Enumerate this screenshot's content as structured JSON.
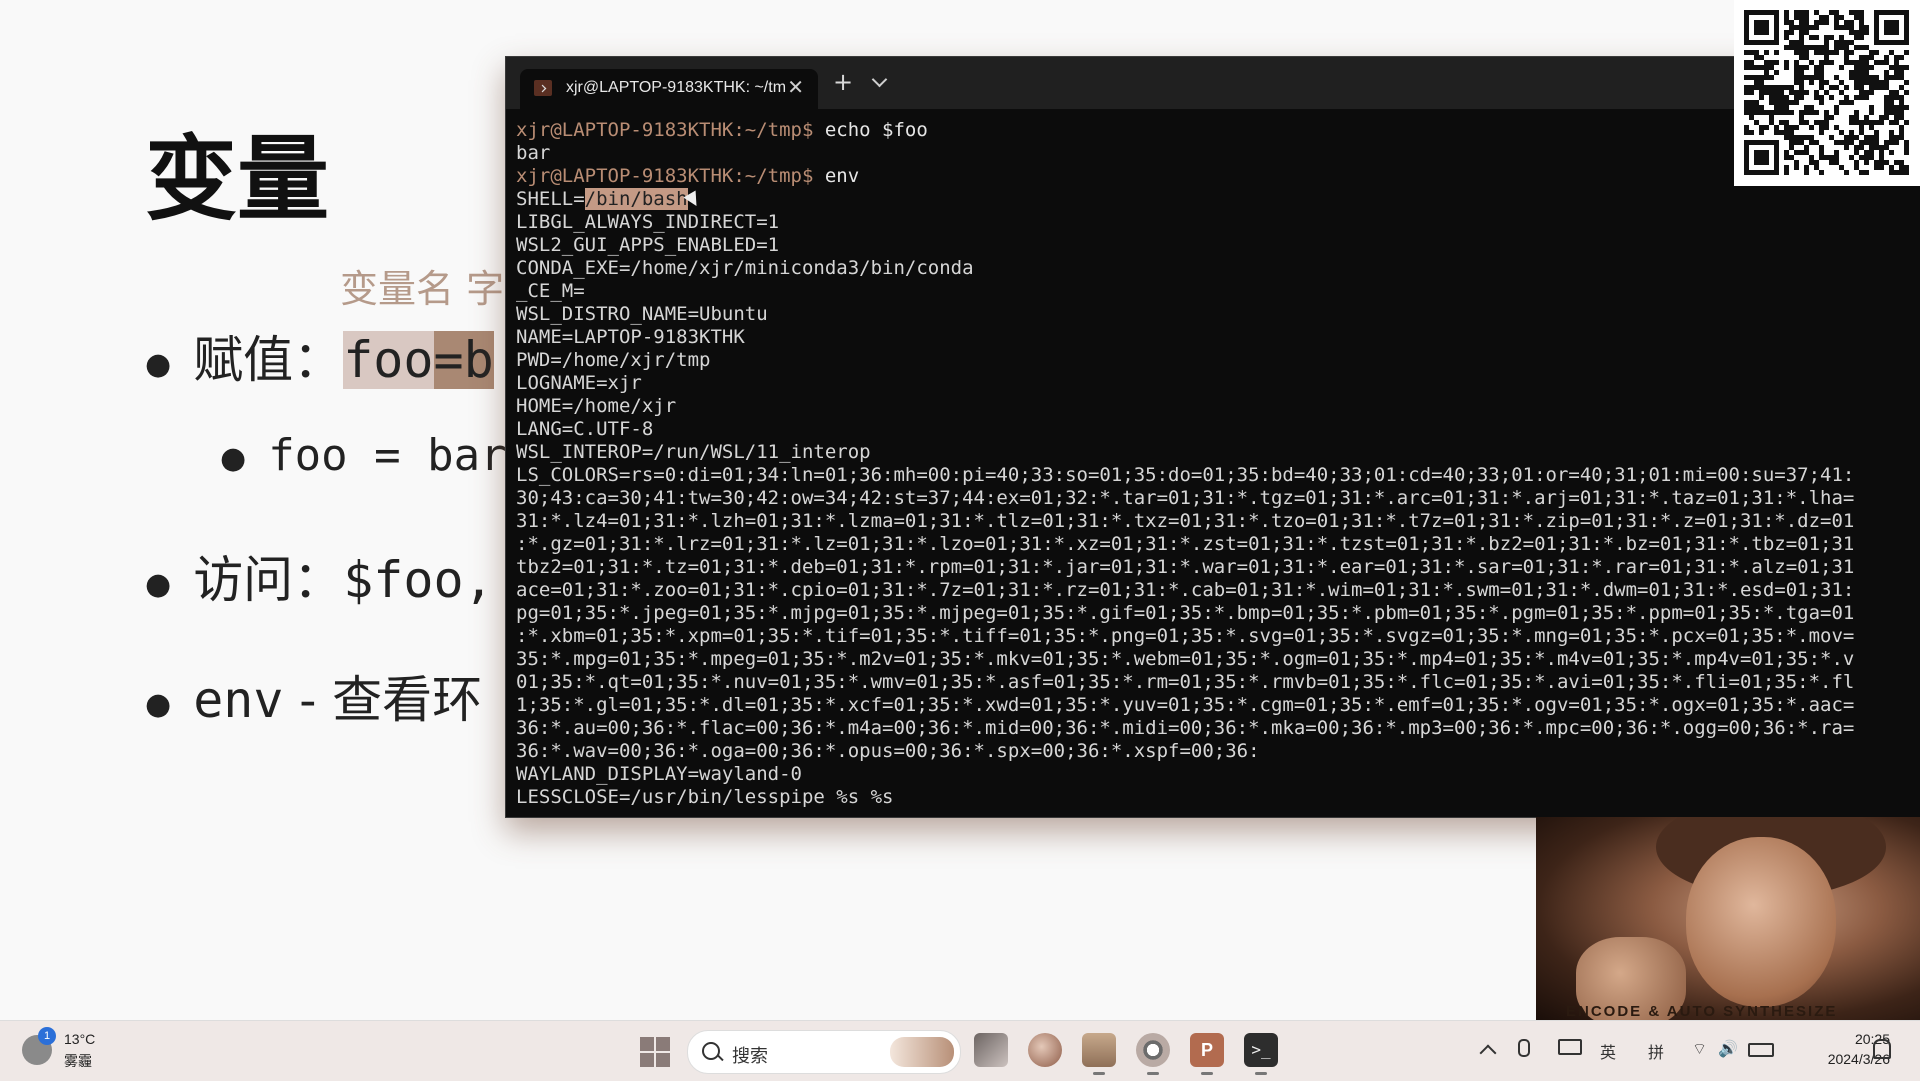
{
  "slide": {
    "faint_header": "",
    "title": "变量",
    "subtitle": "变量名  字",
    "bullets": [
      {
        "label": "赋值：",
        "code": "foo",
        "code2": "=b"
      },
      {
        "code": "foo  =  bar"
      },
      {
        "label": "访问：",
        "code": "$foo,"
      },
      {
        "code": "env",
        "label": " - 查看环"
      }
    ]
  },
  "terminal": {
    "tab_title": "xjr@LAPTOP-9183KTHK: ~/tm",
    "tab_close": "✕",
    "new_tab": "+",
    "prompt": "xjr@LAPTOP-9183KTHK:~/tmp$",
    "cmd1": " echo $foo",
    "out1": "bar",
    "cmd2": " env",
    "shell_key": "SHELL=",
    "shell_val": "/bin/bash",
    "env_lines": [
      "LIBGL_ALWAYS_INDIRECT=1",
      "WSL2_GUI_APPS_ENABLED=1",
      "CONDA_EXE=/home/xjr/miniconda3/bin/conda",
      "_CE_M=",
      "WSL_DISTRO_NAME=Ubuntu",
      "NAME=LAPTOP-9183KTHK",
      "PWD=/home/xjr/tmp",
      "LOGNAME=xjr",
      "HOME=/home/xjr",
      "LANG=C.UTF-8",
      "WSL_INTEROP=/run/WSL/11_interop",
      "LS_COLORS=rs=0:di=01;34:ln=01;36:mh=00:pi=40;33:so=01;35:do=01;35:bd=40;33;01:cd=40;33;01:or=40;31;01:mi=00:su=37;41:",
      "30;43:ca=30;41:tw=30;42:ow=34;42:st=37;44:ex=01;32:*.tar=01;31:*.tgz=01;31:*.arc=01;31:*.arj=01;31:*.taz=01;31:*.lha=",
      "31:*.lz4=01;31:*.lzh=01;31:*.lzma=01;31:*.tlz=01;31:*.txz=01;31:*.tzo=01;31:*.t7z=01;31:*.zip=01;31:*.z=01;31:*.dz=01",
      ":*.gz=01;31:*.lrz=01;31:*.lz=01;31:*.lzo=01;31:*.xz=01;31:*.zst=01;31:*.tzst=01;31:*.bz2=01;31:*.bz=01;31:*.tbz=01;31",
      "tbz2=01;31:*.tz=01;31:*.deb=01;31:*.rpm=01;31:*.jar=01;31:*.war=01;31:*.ear=01;31:*.sar=01;31:*.rar=01;31:*.alz=01;31",
      "ace=01;31:*.zoo=01;31:*.cpio=01;31:*.7z=01;31:*.rz=01;31:*.cab=01;31:*.wim=01;31:*.swm=01;31:*.dwm=01;31:*.esd=01;31:",
      "pg=01;35:*.jpeg=01;35:*.mjpg=01;35:*.mjpeg=01;35:*.gif=01;35:*.bmp=01;35:*.pbm=01;35:*.pgm=01;35:*.ppm=01;35:*.tga=01",
      ":*.xbm=01;35:*.xpm=01;35:*.tif=01;35:*.tiff=01;35:*.png=01;35:*.svg=01;35:*.svgz=01;35:*.mng=01;35:*.pcx=01;35:*.mov=",
      "35:*.mpg=01;35:*.mpeg=01;35:*.m2v=01;35:*.mkv=01;35:*.webm=01;35:*.ogm=01;35:*.mp4=01;35:*.m4v=01;35:*.mp4v=01;35:*.v",
      "01;35:*.qt=01;35:*.nuv=01;35:*.wmv=01;35:*.asf=01;35:*.rm=01;35:*.rmvb=01;35:*.flc=01;35:*.avi=01;35:*.fli=01;35:*.fl",
      "1;35:*.gl=01;35:*.dl=01;35:*.xcf=01;35:*.xwd=01;35:*.yuv=01;35:*.cgm=01;35:*.emf=01;35:*.ogv=01;35:*.ogx=01;35:*.aac=",
      "36:*.au=00;36:*.flac=00;36:*.m4a=00;36:*.mid=00;36:*.midi=00;36:*.mka=00;36:*.mp3=00;36:*.mpc=00;36:*.ogg=00;36:*.ra=",
      "36:*.wav=00;36:*.oga=00;36:*.opus=00;36:*.spx=00;36:*.xspf=00;36:",
      "WAYLAND_DISPLAY=wayland-0",
      "LESSCLOSE=/usr/bin/lesspipe %s %s"
    ]
  },
  "webcam": {
    "caption": "ENCODE & AUTO SYNTHESIZE"
  },
  "taskbar": {
    "weather_badge": "1",
    "temperature": "13°C",
    "condition": "雾霾",
    "search_placeholder": "搜索",
    "ppt_label": "P",
    "terminal_label": ">_",
    "ime_lang": "英",
    "ime_mode": "拼",
    "wifi": "⌔",
    "volume": "🔊",
    "time": "20:25",
    "date": "2024/3/26"
  },
  "colors": {
    "terminal_bg": "#0c0c0c",
    "prompt": "#b98d74",
    "selection": "#c49a85",
    "taskbar_bg": "#efe8e6"
  }
}
